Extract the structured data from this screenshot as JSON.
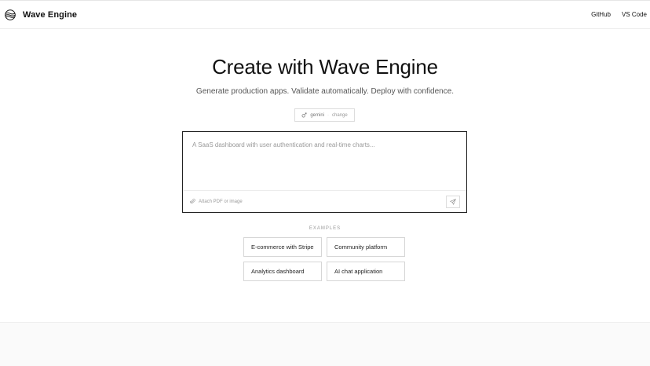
{
  "header": {
    "brand_name": "Wave Engine",
    "logo_icon": "wave-logo-icon",
    "nav": [
      {
        "label": "GitHub"
      },
      {
        "label": "VS Code"
      }
    ]
  },
  "hero": {
    "title": "Create with Wave Engine",
    "subtitle": "Generate production apps. Validate automatically. Deploy with confidence."
  },
  "model_selector": {
    "icon": "model-icon",
    "model": "gemini",
    "separator": "·",
    "change_label": "change"
  },
  "composer": {
    "placeholder": "A SaaS dashboard with user authentication and real-time charts...",
    "value": "",
    "attach_icon": "paperclip-icon",
    "attach_label": "Attach PDF or image",
    "send_icon": "send-icon"
  },
  "examples": {
    "label": "EXAMPLES",
    "items": [
      {
        "label": "E-commerce with Stripe"
      },
      {
        "label": "Community platform"
      },
      {
        "label": "Analytics dashboard"
      },
      {
        "label": "AI chat application"
      }
    ]
  },
  "colors": {
    "text": "#111111",
    "muted": "#999999",
    "border": "#d6d6d6",
    "composer_border": "#222222",
    "footer_band": "#fafafa"
  }
}
